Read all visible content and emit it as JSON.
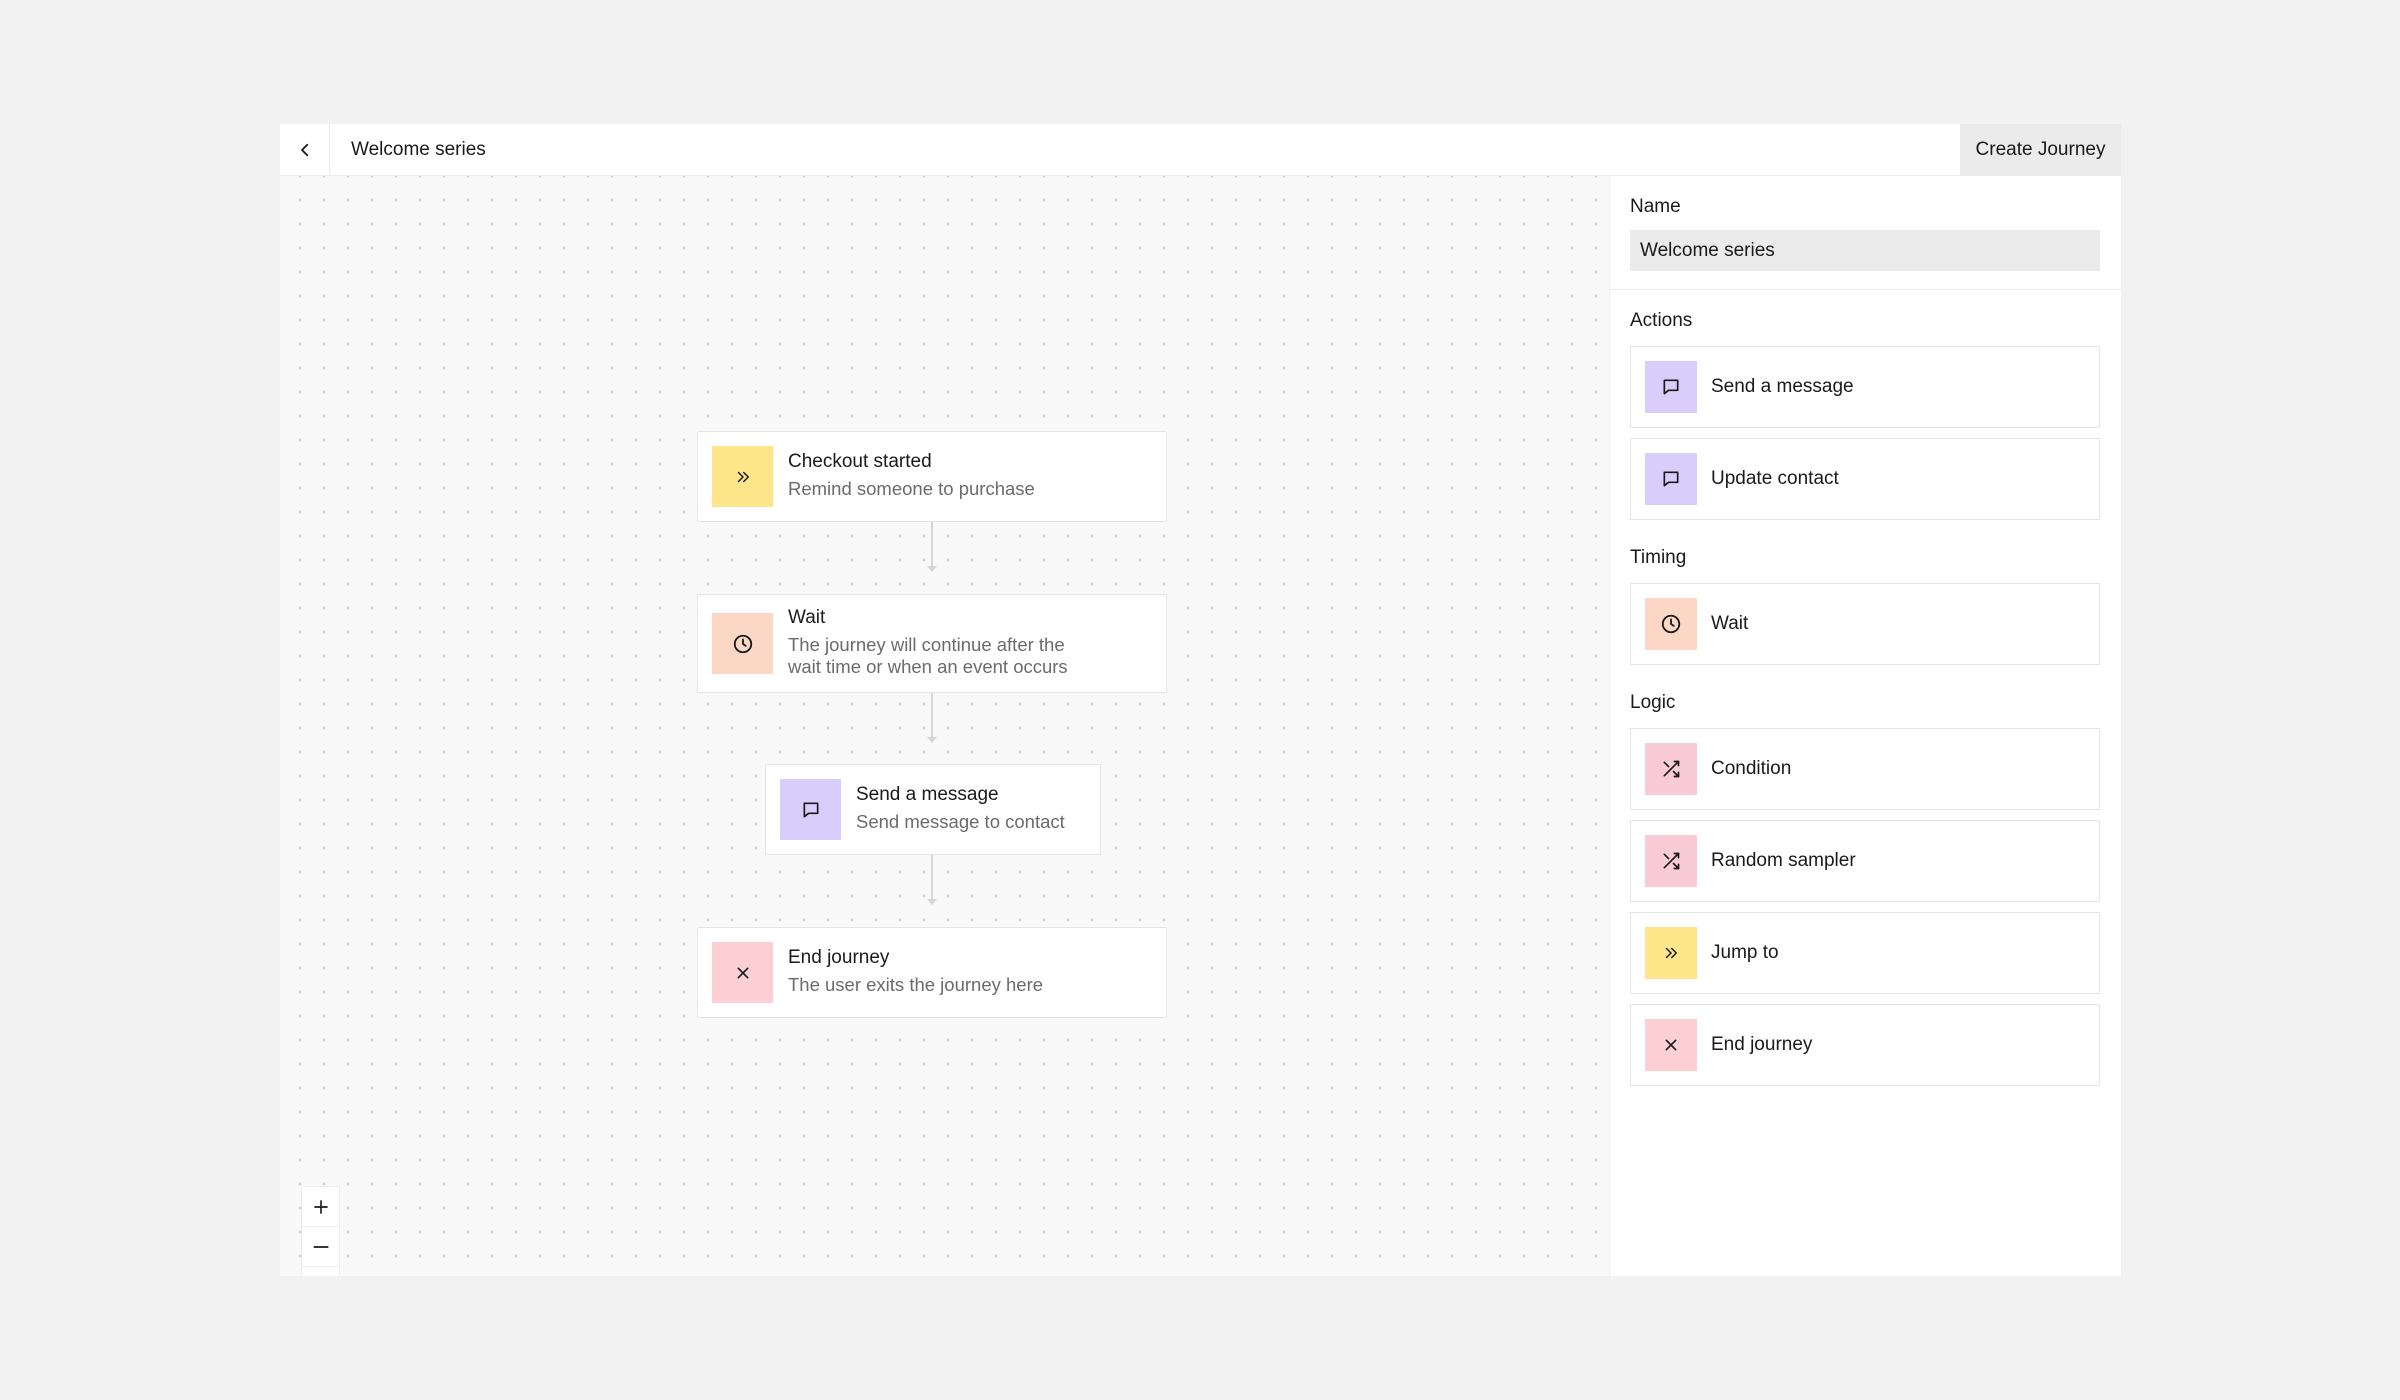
{
  "header": {
    "title": "Welcome series",
    "create_label": "Create Journey"
  },
  "canvas": {
    "nodes": [
      {
        "title": "Checkout started",
        "description": "Remind someone to purchase",
        "icon": "chevrons-right-icon",
        "color": "#fde58a"
      },
      {
        "title": "Wait",
        "description_line1": "The journey will continue after the",
        "description_line2": "wait time or when an event occurs",
        "icon": "clock-icon",
        "color": "#fcd7c5"
      },
      {
        "title": "Send a message",
        "description": "Send message to contact",
        "icon": "message-icon",
        "color": "#d8cdfb"
      },
      {
        "title": "End journey",
        "description": "The user exits the journey here",
        "icon": "close-icon",
        "color": "#fbcfd3"
      }
    ],
    "zoom": {
      "zoom_in": "+",
      "zoom_out": "—",
      "reset_icon": "reset-view-icon"
    }
  },
  "sidebar": {
    "name_label": "Name",
    "name_value": "Welcome series",
    "groups": {
      "actions": {
        "label": "Actions",
        "items": [
          {
            "label": "Send a message",
            "icon": "message-icon",
            "color": "#d8cdfb"
          },
          {
            "label": "Update contact",
            "icon": "message-icon",
            "color": "#d8cdfb"
          }
        ]
      },
      "timing": {
        "label": "Timing",
        "items": [
          {
            "label": "Wait",
            "icon": "clock-icon",
            "color": "#fcd7c5"
          }
        ]
      },
      "logic": {
        "label": "Logic",
        "items": [
          {
            "label": "Condition",
            "icon": "shuffle-icon",
            "color": "#f9cbd6"
          },
          {
            "label": "Random sampler",
            "icon": "shuffle-icon",
            "color": "#f9cbd6"
          },
          {
            "label": "Jump to",
            "icon": "chevrons-right-icon",
            "color": "#fde58a"
          },
          {
            "label": "End journey",
            "icon": "close-icon",
            "color": "#fbcfd3"
          }
        ]
      }
    }
  }
}
